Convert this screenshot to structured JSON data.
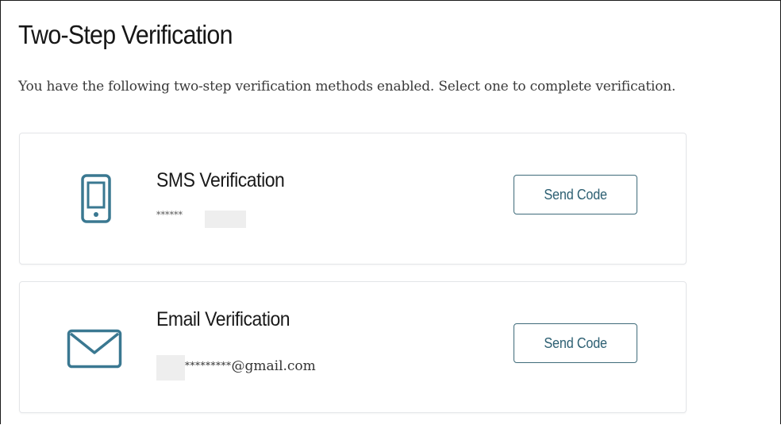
{
  "page": {
    "title": "Two-Step Verification",
    "intro": "You have the following two-step verification methods enabled. Select one to complete verification."
  },
  "methods": [
    {
      "title": "SMS Verification",
      "detail": "******",
      "button_label": "Send Code",
      "icon": "smartphone-icon"
    },
    {
      "title": "Email Verification",
      "detail_masked": "*********",
      "detail_domain": "@gmail.com",
      "button_label": "Send Code",
      "icon": "envelope-icon"
    }
  ],
  "colors": {
    "accent": "#3a7891",
    "button_text": "#2c5f72",
    "card_border": "#e3e5e8"
  }
}
